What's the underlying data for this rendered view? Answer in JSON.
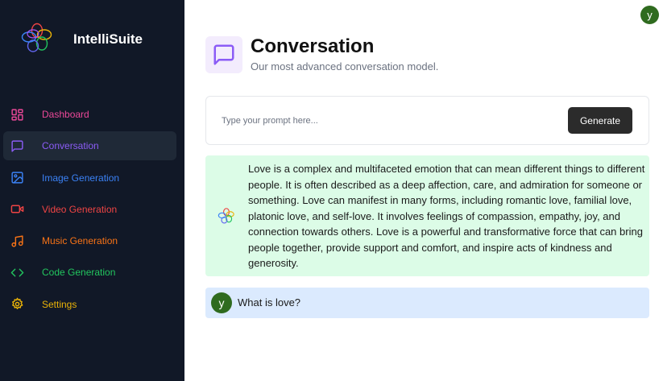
{
  "brand": {
    "name": "IntelliSuite",
    "logo_icon": "flower-logo-icon"
  },
  "sidebar": {
    "items": [
      {
        "label": "Dashboard",
        "icon": "layout-dashboard-icon",
        "color": "#ec4899",
        "active": false
      },
      {
        "label": "Conversation",
        "icon": "message-square-icon",
        "color": "#8b5cf6",
        "active": true
      },
      {
        "label": "Image Generation",
        "icon": "image-icon",
        "color": "#3b82f6",
        "active": false
      },
      {
        "label": "Video Generation",
        "icon": "video-icon",
        "color": "#ef4444",
        "active": false
      },
      {
        "label": "Music Generation",
        "icon": "music-icon",
        "color": "#f97316",
        "active": false
      },
      {
        "label": "Code Generation",
        "icon": "code-icon",
        "color": "#22c55e",
        "active": false
      },
      {
        "label": "Settings",
        "icon": "settings-icon",
        "color": "#eab308",
        "active": false
      }
    ]
  },
  "user": {
    "avatar_letter": "y",
    "avatar_color": "#2f6b1f"
  },
  "header": {
    "title": "Conversation",
    "subtitle": "Our most advanced conversation model.",
    "icon": "message-square-icon",
    "icon_color": "#8b5cf6"
  },
  "prompt": {
    "placeholder": "Type your prompt here...",
    "value": "",
    "button_label": "Generate"
  },
  "messages": [
    {
      "role": "bot",
      "icon": "flower-logo-icon",
      "text": "Love is a complex and multifaceted emotion that can mean different things to different people. It is often described as a deep affection, care, and admiration for someone or something. Love can manifest in many forms, including romantic love, familial love, platonic love, and self-love. It involves feelings of compassion, empathy, joy, and connection towards others. Love is a powerful and transformative force that can bring people together, provide support and comfort, and inspire acts of kindness and generosity."
    },
    {
      "role": "user",
      "avatar_letter": "y",
      "text": "What is love?"
    }
  ],
  "colors": {
    "sidebar_bg": "#111827",
    "bot_bg": "#dcfce7",
    "user_bg": "#dbeafe",
    "button_bg": "#2b2b2b"
  }
}
